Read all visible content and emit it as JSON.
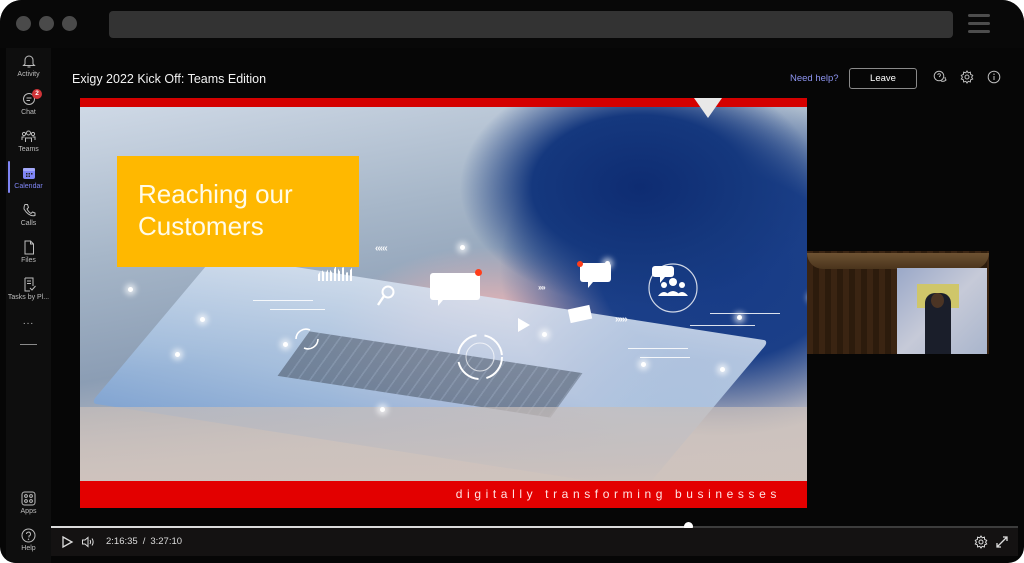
{
  "window": {
    "controls": [
      "close",
      "minimize",
      "maximize"
    ],
    "menu_icon": "hamburger-icon"
  },
  "sidebar": {
    "items": [
      {
        "label": "Activity",
        "icon": "bell-icon",
        "active": false
      },
      {
        "label": "Chat",
        "icon": "chat-icon",
        "active": false,
        "badge": "2"
      },
      {
        "label": "Teams",
        "icon": "teams-icon",
        "active": false
      },
      {
        "label": "Calendar",
        "icon": "calendar-icon",
        "active": true
      },
      {
        "label": "Calls",
        "icon": "phone-icon",
        "active": false
      },
      {
        "label": "Files",
        "icon": "file-icon",
        "active": false
      },
      {
        "label": "Tasks by Pl...",
        "icon": "tasks-icon",
        "active": false
      }
    ],
    "more_label": "...",
    "bottom_items": [
      {
        "label": "Apps",
        "icon": "apps-icon"
      },
      {
        "label": "Help",
        "icon": "help-icon"
      }
    ],
    "active_color": "#7f85f5"
  },
  "header": {
    "meeting_title": "Exigy 2022 Kick Off: Teams Edition",
    "need_help": "Need help?",
    "leave_label": "Leave",
    "icons": [
      "feedback-icon",
      "settings-icon",
      "info-icon"
    ]
  },
  "slide": {
    "title": "Reaching our\nCustomers",
    "tagline": "digitally transforming businesses",
    "accent_red": "#e30000",
    "title_box_color": "#ffb800"
  },
  "player": {
    "current_time": "2:16:35",
    "separator": "/",
    "total_time": "3:27:10",
    "progress_fraction": 0.659
  }
}
